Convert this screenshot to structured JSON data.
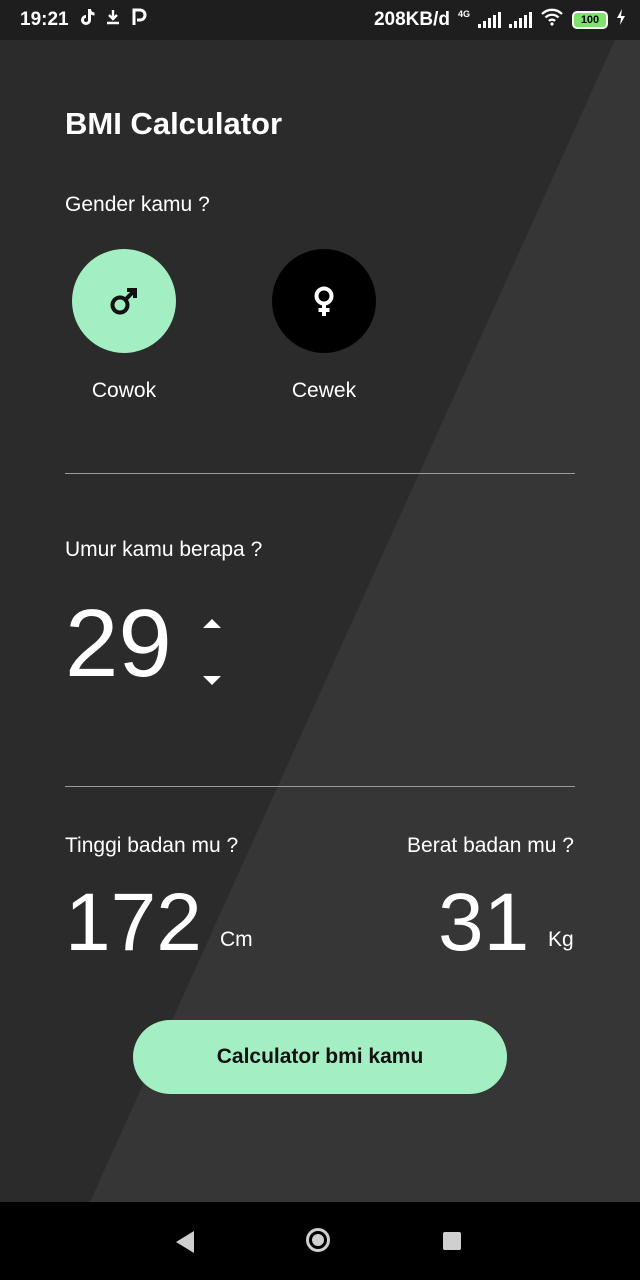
{
  "status_bar": {
    "time": "19:21",
    "speed": "208KB/d",
    "network": "4G",
    "battery": "100",
    "icons": [
      "tiktok-icon",
      "download-icon",
      "p-app-icon",
      "signal-icon",
      "wifi-icon",
      "battery-icon",
      "charging-icon"
    ]
  },
  "app": {
    "title": "BMI Calculator",
    "gender": {
      "question": "Gender kamu ?",
      "options": [
        {
          "label": "Cowok",
          "icon": "male-icon",
          "selected": true,
          "color": "#a3efc3"
        },
        {
          "label": "Cewek",
          "icon": "female-icon",
          "selected": false,
          "color": "#000000"
        }
      ]
    },
    "age": {
      "question": "Umur kamu berapa ?",
      "value": "29"
    },
    "height": {
      "question": "Tinggi badan mu ?",
      "value": "172",
      "unit": "Cm"
    },
    "weight": {
      "question": "Berat badan mu ?",
      "value": "31",
      "unit": "Kg"
    },
    "calculate_button": "Calculator bmi kamu"
  },
  "colors": {
    "accent": "#a3efc3",
    "background": "#2b2b2b",
    "text": "#ffffff"
  }
}
